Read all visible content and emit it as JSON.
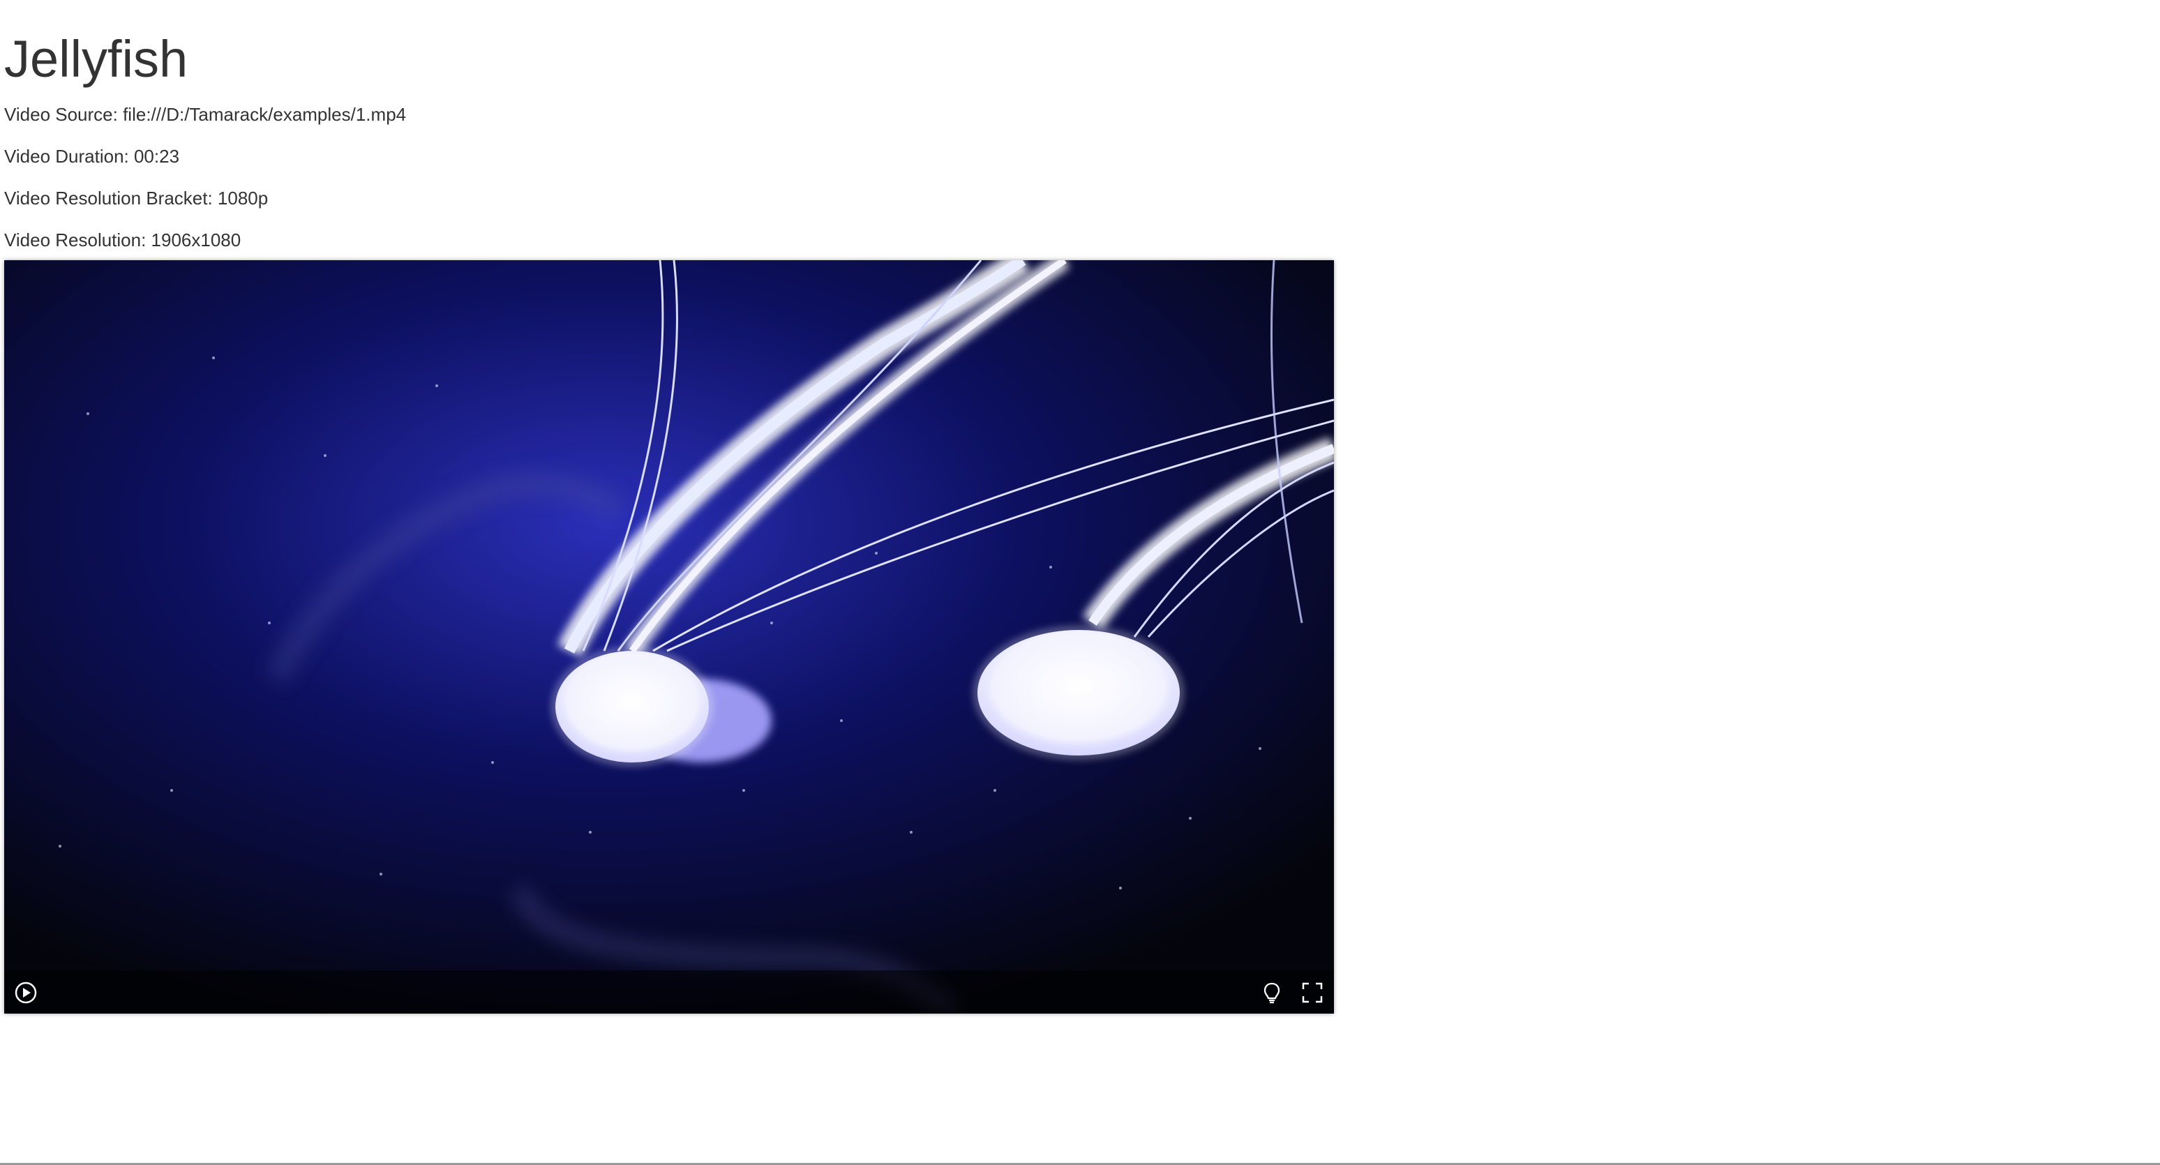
{
  "page": {
    "title": "Jellyfish"
  },
  "video_info": {
    "source": "Video Source: file:///D:/Tamarack/examples/1.mp4",
    "duration": "Video Duration: 00:23",
    "bracket": "Video Resolution Bracket: 1080p",
    "resolution": "Video Resolution: 1906x1080"
  },
  "player": {
    "controls": {
      "play_icon": "play-circle-icon",
      "light_icon": "lightbulb-icon",
      "fullscreen_icon": "fullscreen-icon"
    }
  },
  "colors": {
    "text": "#333333",
    "video_background": "#05060d",
    "glow": "#6a6cff"
  }
}
